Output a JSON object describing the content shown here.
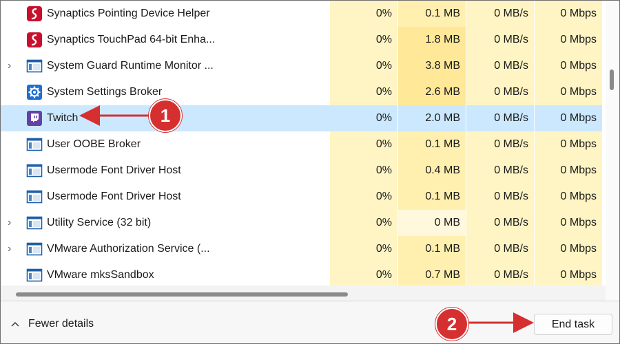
{
  "processes": [
    {
      "name": "Synaptics Pointing Device Helper",
      "icon": "synaptics-icon",
      "expandable": false,
      "cpu": "0%",
      "memory": "0.1 MB",
      "disk": "0 MB/s",
      "network": "0 Mbps",
      "selected": false
    },
    {
      "name": "Synaptics TouchPad 64-bit Enha...",
      "icon": "synaptics-icon",
      "expandable": false,
      "cpu": "0%",
      "memory": "1.8 MB",
      "disk": "0 MB/s",
      "network": "0 Mbps",
      "selected": false
    },
    {
      "name": "System Guard Runtime Monitor ...",
      "icon": "window-app-icon",
      "expandable": true,
      "cpu": "0%",
      "memory": "3.8 MB",
      "disk": "0 MB/s",
      "network": "0 Mbps",
      "selected": false
    },
    {
      "name": "System Settings Broker",
      "icon": "settings-gear-icon",
      "expandable": false,
      "cpu": "0%",
      "memory": "2.6 MB",
      "disk": "0 MB/s",
      "network": "0 Mbps",
      "selected": false
    },
    {
      "name": "Twitch",
      "icon": "twitch-icon",
      "expandable": false,
      "cpu": "0%",
      "memory": "2.0 MB",
      "disk": "0 MB/s",
      "network": "0 Mbps",
      "selected": true
    },
    {
      "name": "User OOBE Broker",
      "icon": "window-app-icon",
      "expandable": false,
      "cpu": "0%",
      "memory": "0.1 MB",
      "disk": "0 MB/s",
      "network": "0 Mbps",
      "selected": false
    },
    {
      "name": "Usermode Font Driver Host",
      "icon": "window-app-icon",
      "expandable": false,
      "cpu": "0%",
      "memory": "0.4 MB",
      "disk": "0 MB/s",
      "network": "0 Mbps",
      "selected": false
    },
    {
      "name": "Usermode Font Driver Host",
      "icon": "window-app-icon",
      "expandable": false,
      "cpu": "0%",
      "memory": "0.1 MB",
      "disk": "0 MB/s",
      "network": "0 Mbps",
      "selected": false
    },
    {
      "name": "Utility Service (32 bit)",
      "icon": "window-app-icon",
      "expandable": true,
      "cpu": "0%",
      "memory": "0 MB",
      "disk": "0 MB/s",
      "network": "0 Mbps",
      "selected": false
    },
    {
      "name": "VMware Authorization Service (...",
      "icon": "window-app-icon",
      "expandable": true,
      "cpu": "0%",
      "memory": "0.1 MB",
      "disk": "0 MB/s",
      "network": "0 Mbps",
      "selected": false
    },
    {
      "name": "VMware mksSandbox",
      "icon": "window-app-icon",
      "expandable": false,
      "cpu": "0%",
      "memory": "0.7 MB",
      "disk": "0 MB/s",
      "network": "0 Mbps",
      "selected": false
    }
  ],
  "footer": {
    "fewer_details_label": "Fewer details",
    "end_task_label": "End task"
  },
  "annotations": {
    "step1": "1",
    "step2": "2"
  },
  "colors": {
    "selection": "#cce8ff",
    "heat_light": "#fff4c4",
    "heat_memory": "#fff0b0",
    "annotation_red": "#d62f2f"
  }
}
